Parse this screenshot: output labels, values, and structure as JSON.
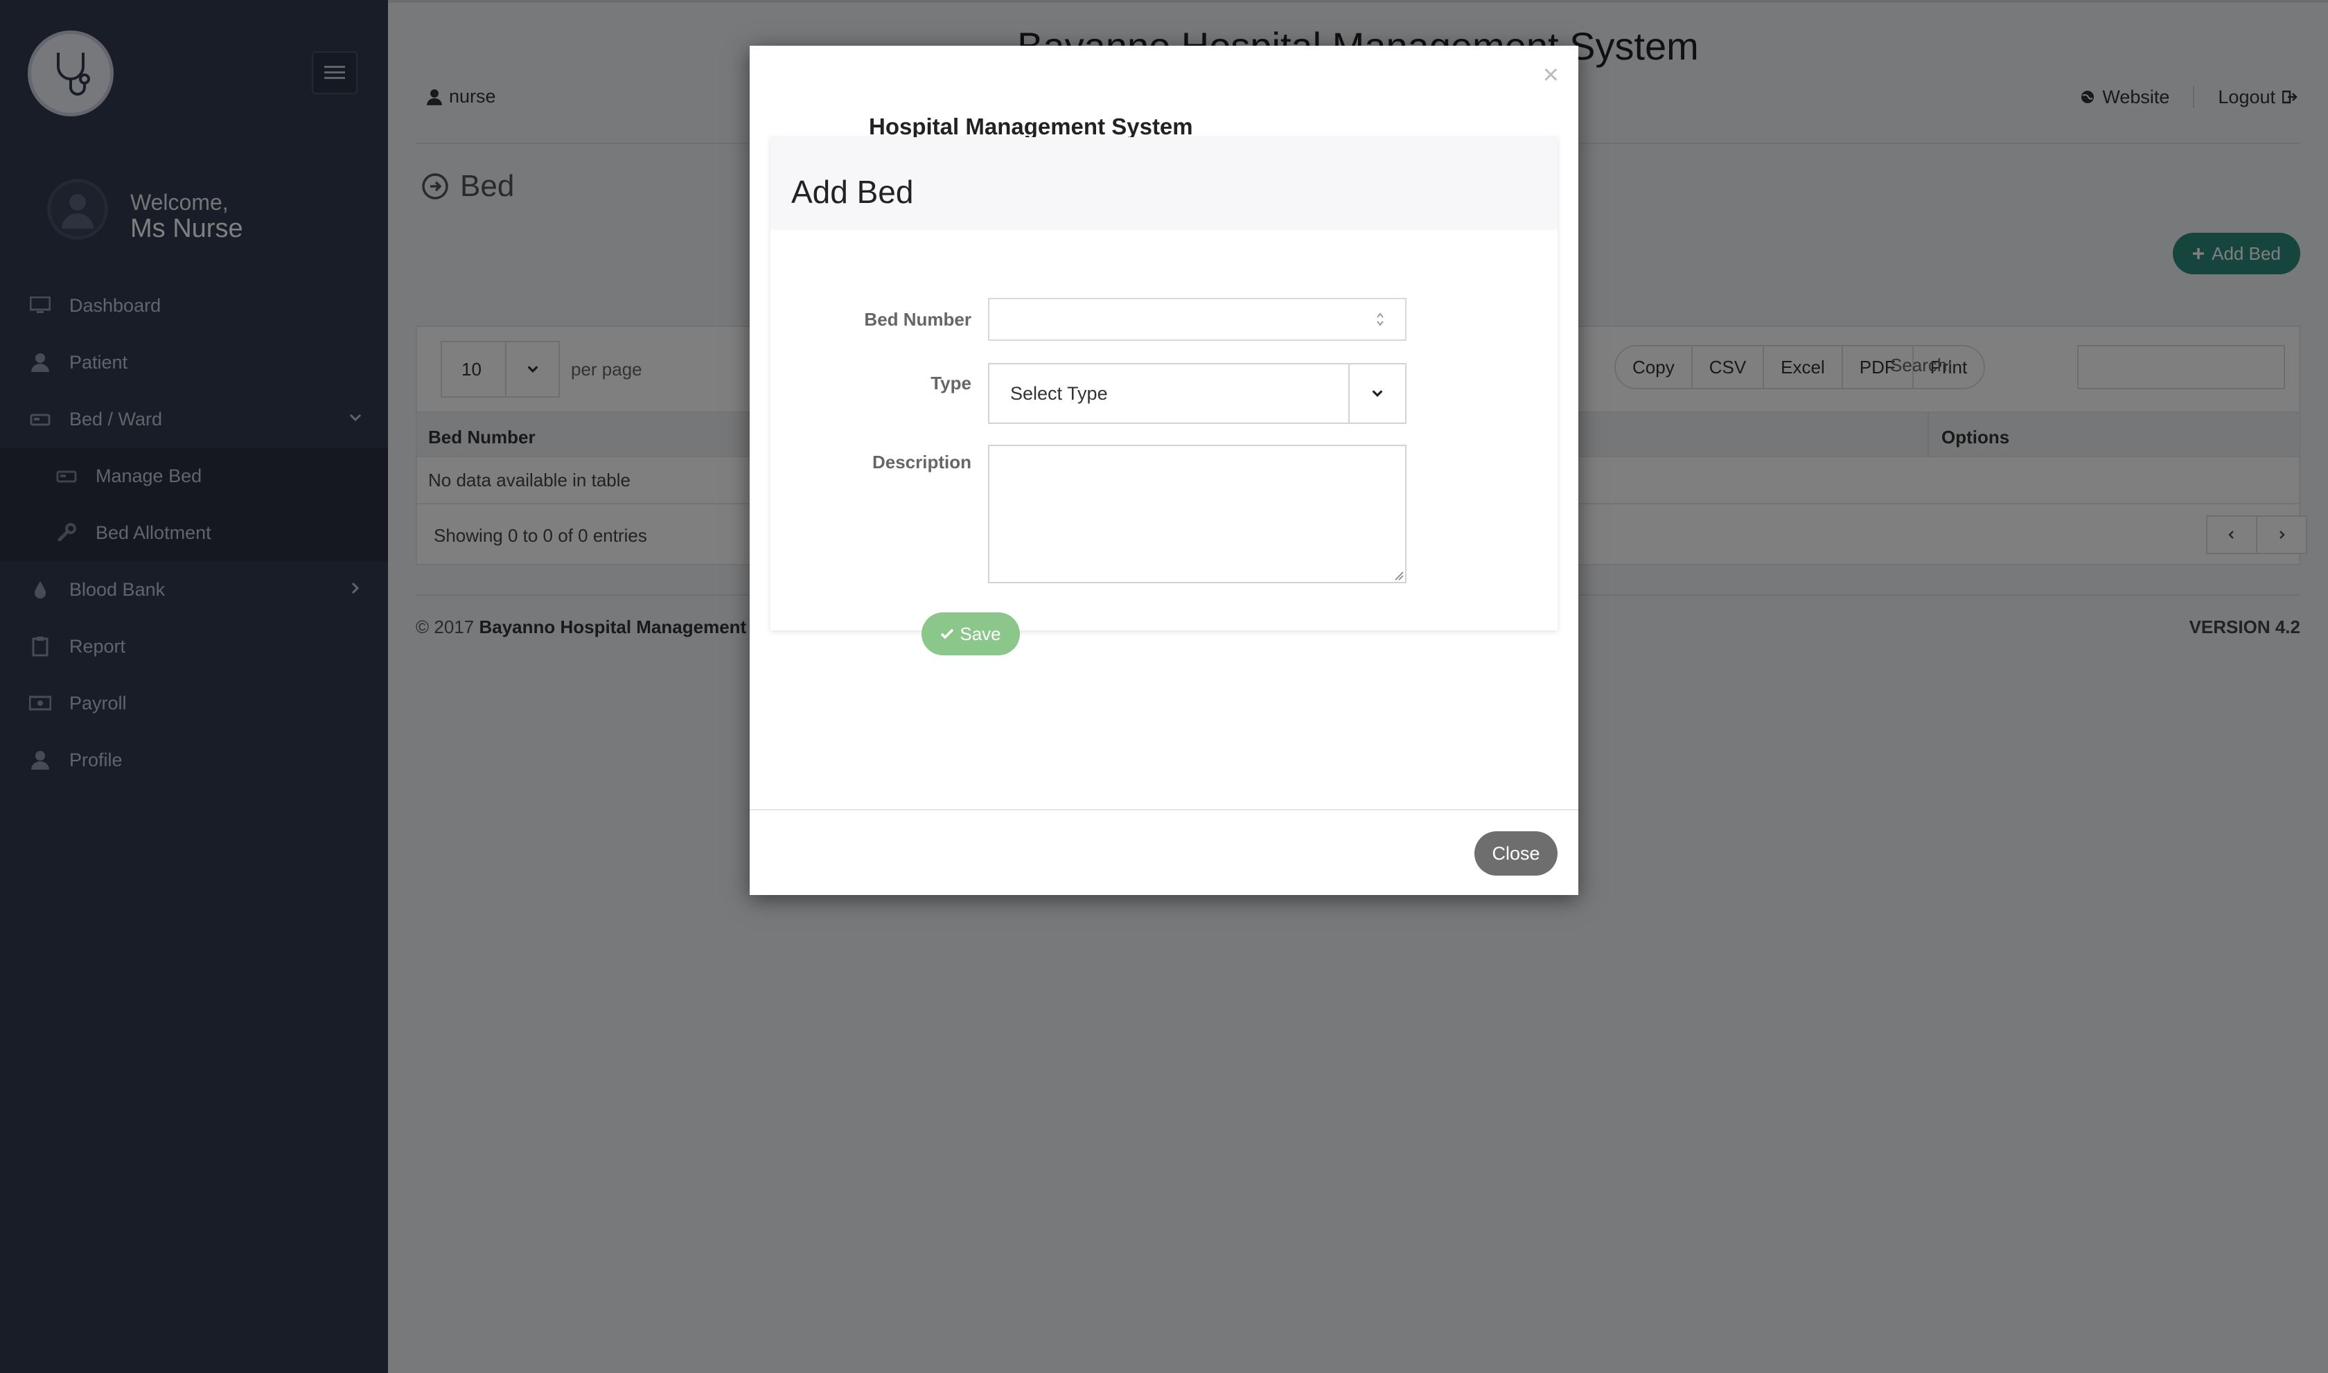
{
  "app": {
    "title": "Bayanno Hospital Management System"
  },
  "header": {
    "user": "nurse",
    "website_label": "Website",
    "logout_label": "Logout"
  },
  "sidebar": {
    "welcome": "Welcome,",
    "user_name": "Ms Nurse",
    "items": [
      {
        "label": "Dashboard",
        "icon": "desktop-icon"
      },
      {
        "label": "Patient",
        "icon": "user-icon"
      },
      {
        "label": "Bed / Ward",
        "icon": "bed-icon"
      },
      {
        "label": "Manage Bed",
        "icon": "bed-icon"
      },
      {
        "label": "Bed Allotment",
        "icon": "wrench-icon"
      },
      {
        "label": "Blood Bank",
        "icon": "drop-icon"
      },
      {
        "label": "Report",
        "icon": "clipboard-icon"
      },
      {
        "label": "Payroll",
        "icon": "money-icon"
      },
      {
        "label": "Profile",
        "icon": "user-icon"
      }
    ]
  },
  "page": {
    "title": "Bed",
    "add_button": "Add Bed",
    "table": {
      "length_value": "10",
      "per_page": "per page",
      "export_buttons": [
        "Copy",
        "CSV",
        "Excel",
        "PDF",
        "Print"
      ],
      "search_label": "Search:",
      "columns": [
        "Bed Number",
        "Options"
      ],
      "empty_text": "No data available in table",
      "info": "Showing 0 to 0 of 0 entries"
    }
  },
  "footer": {
    "copyright_prefix": "© 2017",
    "copyright_name": "Bayanno Hospital Management S",
    "version": "VERSION 4.2"
  },
  "modal": {
    "title": "Hospital Management System",
    "form_title": "Add Bed",
    "fields": {
      "bed_number_label": "Bed Number",
      "bed_number_value": "",
      "type_label": "Type",
      "type_value": "Select Type",
      "description_label": "Description",
      "description_value": ""
    },
    "save_label": "Save",
    "close_label": "Close",
    "close_x": "×"
  },
  "colors": {
    "sidebar_bg": "#323a4f",
    "accent_teal": "#2d8a7c",
    "save_green": "#8bc78b",
    "close_gray": "#6e6e6e"
  }
}
